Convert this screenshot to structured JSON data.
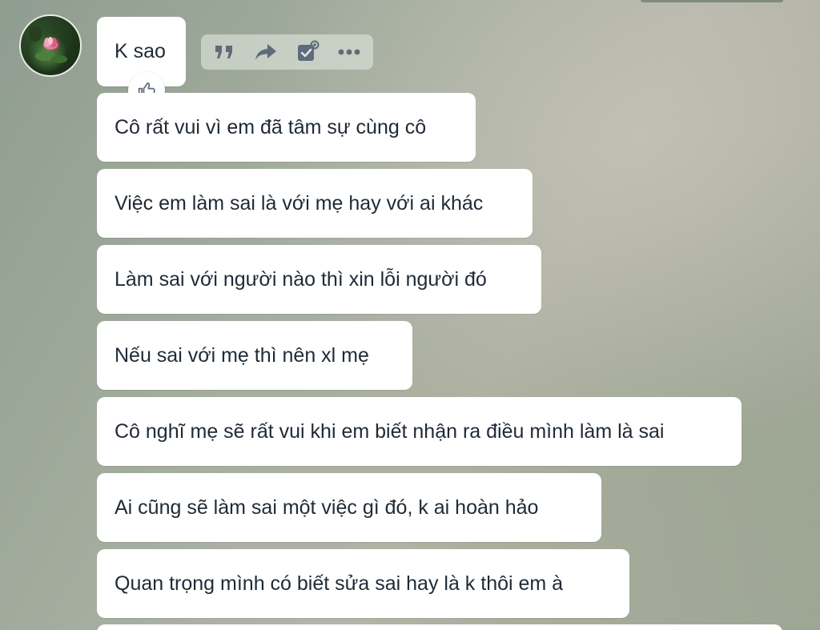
{
  "conversation": {
    "messages": [
      {
        "text": "K sao"
      },
      {
        "text": "Cô rất vui vì em đã tâm sự cùng cô"
      },
      {
        "text": "Việc em làm sai là với mẹ hay với ai khác"
      },
      {
        "text": "Làm sai với người nào thì xin lỗi người đó"
      },
      {
        "text": "Nếu sai với mẹ thì nên xl mẹ"
      },
      {
        "text": "Cô nghĩ mẹ sẽ rất vui khi em biết nhận ra điều mình làm là sai"
      },
      {
        "text": "Ai cũng sẽ làm sai một việc gì đó, k ai hoàn hảo"
      },
      {
        "text": "Quan trọng mình có biết sửa sai hay là k thôi em à"
      }
    ]
  },
  "message_actions": {
    "icons": [
      "quote-icon",
      "forward-icon",
      "task-icon",
      "more-icon"
    ],
    "icon_color": "#5d6b7a"
  },
  "reaction": {
    "icon": "thumbs-up-icon"
  },
  "colors": {
    "bubble_bg": "#ffffff",
    "text": "#1f2a36"
  }
}
